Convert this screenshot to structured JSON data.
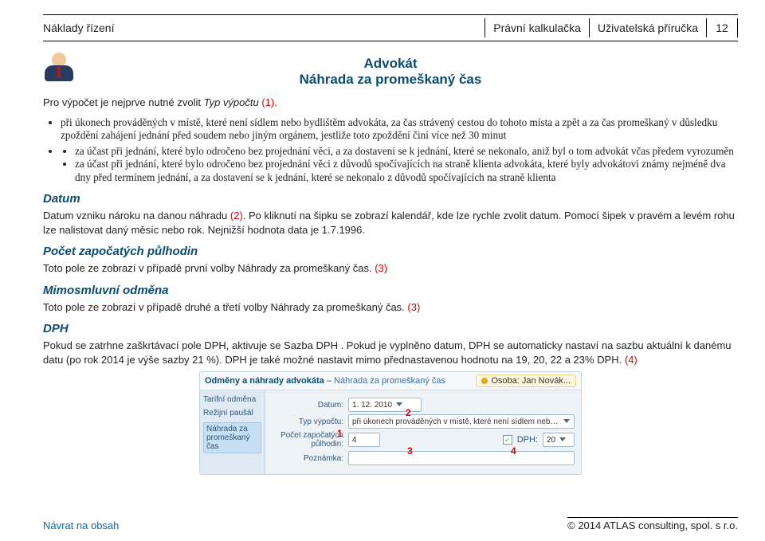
{
  "header": {
    "left": "Náklady řízení",
    "mid": "Právní kalkulačka",
    "right": "Uživatelská příručka",
    "page": "12"
  },
  "avatar_name": "person-icon",
  "section_title": {
    "line1": "Advokát",
    "line2": "Náhrada za promeškaný čas"
  },
  "intro": {
    "prefix": "Pro výpočet je nejprve nutné zvolit ",
    "em": "Typ výpočtu",
    "ref": " (1).",
    "suffix": ""
  },
  "bullets": [
    "při úkonech prováděných v místě, které není sídlem nebo bydlištěm advokáta, za čas strávený cestou do tohoto místa a zpět a za čas promeškaný v důsledku zpoždění zahájení jednání před soudem nebo jiným orgánem, jestliže toto zpoždění činí více než 30 minut",
    "za účast při jednání, které bylo odročeno bez projednání věci, a za dostavení se k jednání, které se nekonalo, aniž byl o tom advokát včas předem vyrozuměn",
    "za účast při jednání, které bylo odročeno bez projednání věci z důvodů spočívajících na straně klienta advokáta, které byly advokátovi známy nejméně dva dny před termínem jednání, a za dostavení se k jednání, které se nekonalo z důvodů spočívajících na straně klienta"
  ],
  "headings": {
    "datum": "Datum",
    "pocet": "Počet započatých půlhodin",
    "mimo": "Mimosmluvní odměna",
    "dph": "DPH"
  },
  "paras": {
    "datum_p1_a": "Datum vzniku nároku na danou náhradu ",
    "datum_p1_ref": "(2)",
    "datum_p1_b": ". Po kliknutí na šipku se zobrazí kalendář, kde lze rychle zvolit datum. Pomocí šipek v pravém a levém rohu lze nalistovat daný měsíc nebo rok. Nejnižší hodnota data je 1.7.1996.",
    "pocet_p_a": "Toto pole ze zobrazí v případě první volby Náhrady za promeškaný čas. ",
    "pocet_p_ref": "(3)",
    "mimo_p_a": "Toto pole ze zobrazí v případě druhé a třetí volby Náhrady za promeškaný čas. ",
    "mimo_p_ref": "(3)",
    "dph_p_a": "Pokud se zatrhne zaškrtávací pole DPH, aktivuje se Sazba DPH . Pokud je vyplněno datum, DPH se automaticky nastaví na sazbu aktuální k danému datu (po rok 2014 je výše sazby 21 %). DPH je také možné nastavit mimo přednastavenou hodnotu na 19, 20, 22 a 23% DPH. ",
    "dph_p_ref": "(4)"
  },
  "footer": {
    "nav": "Návrat na obsah",
    "copy": "© 2014 ATLAS consulting, spol. s r.o."
  },
  "shot": {
    "title_blue": "Odměny a náhrady advokáta",
    "title_dash": " – ",
    "title_sub": "Náhrada za promeškaný čas",
    "person_label": "Osoba: Jan Novák...",
    "side": {
      "a": "Tarifní odměna",
      "b": "Režijní paušál",
      "c": "Náhrada za promeškaný čas"
    },
    "labels": {
      "datum": "Datum:",
      "typ": "Typ výpočtu:",
      "pocet": "Počet započatých půlhodin:",
      "pozn": "Poznámka:",
      "dph": "DPH:"
    },
    "values": {
      "datum": "1. 12. 2010",
      "typ": "při úkonech prováděných v místě, které není sídlem nebo bydlištěm advokáta, za čas...",
      "pocet": "4",
      "dph_checked": "✓",
      "dph": "20"
    },
    "markers": {
      "m1": "1",
      "m2": "2",
      "m3": "3",
      "m4": "4"
    }
  }
}
